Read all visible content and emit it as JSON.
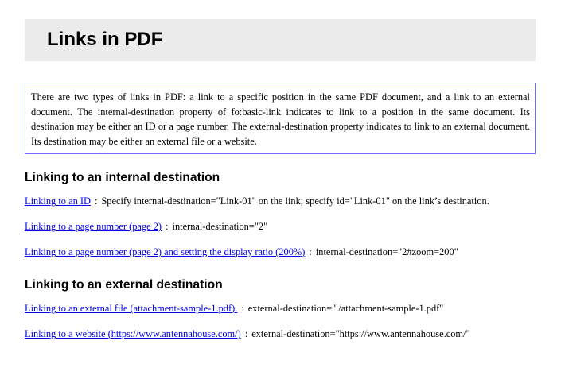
{
  "title": "Links in PDF",
  "intro": "There are two types of links in PDF: a link to a specific position in the same PDF document, and a link to an external document. The internal-destination property of fo:basic-link indicates to link to a position in the same document. Its destination may be either an ID or a page number. The external-destination property indicates to link to an external document. Its destination may be either an external file or a website.",
  "separator": ":",
  "internal": {
    "heading": "Linking to an internal destination",
    "links": [
      {
        "link_text": "Linking to an ID",
        "description": "Specify internal-destination=\"Link-01\" on the link; specify id=\"Link-01\" on the link’s destination."
      },
      {
        "link_text": "Linking to a page number (page 2)",
        "description": "internal-destination=\"2\""
      },
      {
        "link_text": "Linking to a page number (page 2) and setting the display ratio (200%)",
        "description": "internal-destination=\"2#zoom=200\""
      }
    ]
  },
  "external": {
    "heading": "Linking to an external destination",
    "links": [
      {
        "link_text": "Linking to an external file (attachment-sample-1.pdf).",
        "description": "external-destination=\"./attachment-sample-1.pdf\""
      },
      {
        "link_text": "Linking to a website (https://www.antennahouse.com/)",
        "description": "external-destination=\"https://www.antennahouse.com/\""
      }
    ]
  },
  "colors": {
    "link": "#0000ee",
    "title_background": "#ebebeb",
    "intro_border": "#6b6bff"
  }
}
